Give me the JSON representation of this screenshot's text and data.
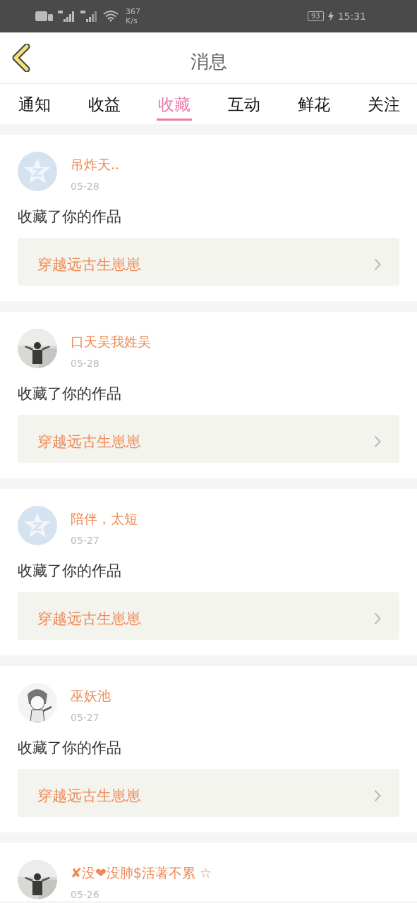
{
  "status_bar": {
    "speed_value": "367",
    "speed_unit": "K/s",
    "battery": "93",
    "charging": true,
    "time": "15:31"
  },
  "header": {
    "title": "消息"
  },
  "tabs": [
    {
      "label": "通知",
      "selected": false
    },
    {
      "label": "收益",
      "selected": false
    },
    {
      "label": "收藏",
      "selected": true
    },
    {
      "label": "互动",
      "selected": false
    },
    {
      "label": "鲜花",
      "selected": false
    },
    {
      "label": "关注",
      "selected": false
    }
  ],
  "messages": [
    {
      "avatar": {
        "kind": "default"
      },
      "name": "吊炸天..",
      "date": "05-28",
      "text": "收藏了你的作品",
      "work": "穿越远古生崽崽"
    },
    {
      "name": "口天吴我姓吴",
      "date": "05-28",
      "text": "收藏了你的作品",
      "work": "穿越远古生崽崽"
    },
    {
      "avatar": {
        "kind": "default"
      },
      "name": "陪伴，太短",
      "date": "05-27",
      "text": "收藏了你的作品",
      "work": "穿越远古生崽崽"
    },
    {
      "name": "巫妖池",
      "date": "05-27",
      "text": "收藏了你的作品",
      "work": "穿越远古生崽崽"
    },
    {
      "name": "✘没❤没肺$活著不累 ☆",
      "date": "05-26"
    }
  ]
}
